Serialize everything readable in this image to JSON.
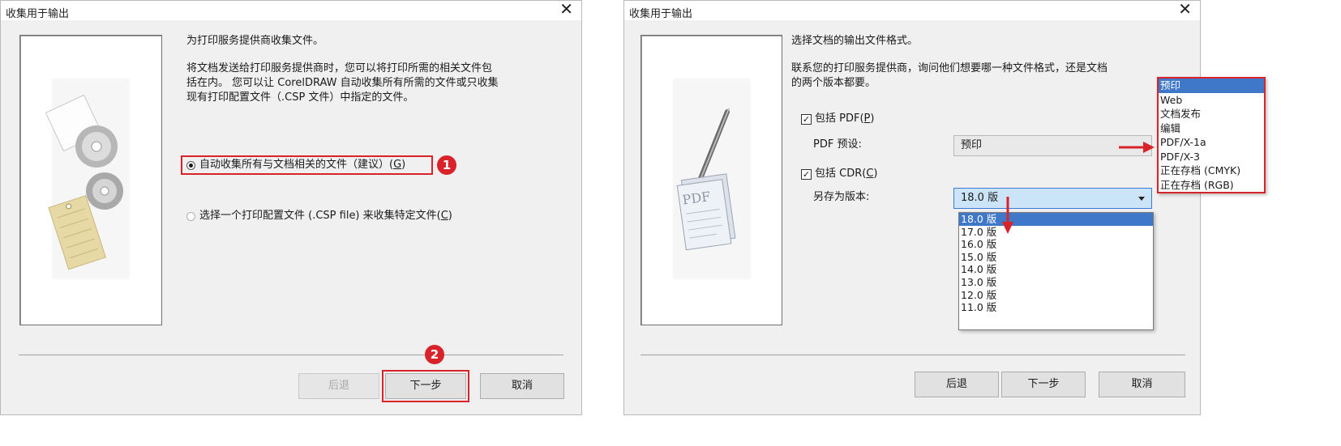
{
  "dialog1": {
    "title": "收集用于输出",
    "close_glyph": "✕",
    "heading": "为打印服务提供商收集文件。",
    "paragraph_line1": "将文档发送给打印服务提供商时，您可以将打印所需的相关文件包",
    "paragraph_line2": "括在内。 您可以让 CorelDRAW 自动收集所有所需的文件或只收集",
    "paragraph_line3": "现有打印配置文件（.CSP 文件）中指定的文件。",
    "option1_label": "自动收集所有与文档相关的文件（建议）(",
    "option1_key": "G",
    "option2_label": "选择一个打印配置文件 (.CSP file) 来收集特定文件(",
    "option2_key": "C",
    "back_button": "后退",
    "next_button": "下一步",
    "cancel_button": "取消",
    "badge1": "1",
    "badge2": "2"
  },
  "dialog2": {
    "title": "收集用于输出",
    "close_glyph": "✕",
    "heading": "选择文档的输出文件格式。",
    "paragraph_line1": "联系您的打印服务提供商，询问他们想要哪一种文件格式，还是文档",
    "paragraph_line2": "的两个版本都要。",
    "include_pdf_label": "包括 PDF(",
    "include_pdf_key": "P",
    "pdf_preset_label": "PDF 预设:",
    "pdf_preset_value": "预印",
    "include_cdr_label": "包括 CDR(",
    "include_cdr_key": "C",
    "save_as_version_label": "另存为版本:",
    "save_as_version_value": "18.0 版",
    "version_options": [
      "18.0 版",
      "17.0 版",
      "16.0 版",
      "15.0 版",
      "14.0 版",
      "13.0 版",
      "12.0 版",
      "11.0 版"
    ],
    "pdf_preset_options": [
      "预印",
      "Web",
      "文档发布",
      "编辑",
      "PDF/X-1a",
      "PDF/X-3",
      "正在存档 (CMYK)",
      "正在存档 (RGB)"
    ],
    "back_button": "后退",
    "next_button": "下一步",
    "cancel_button": "取消"
  },
  "colors": {
    "highlight_red": "#d9232a",
    "selection_blue": "#3f78c9",
    "dialog_bg": "#f0f0f0"
  }
}
